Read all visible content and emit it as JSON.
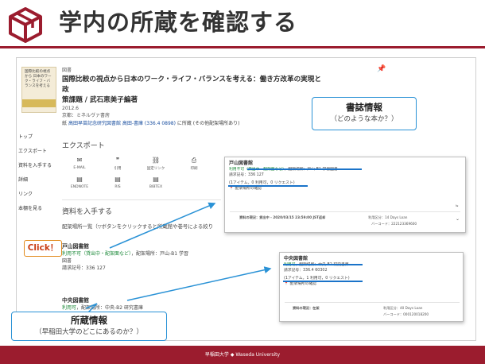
{
  "header": {
    "title": "学内の所蔵を確認する"
  },
  "book": {
    "type": "図書",
    "title_line1": "国際比較の視点から日本のワーク・ライフ・バランスを考える：働き方改革の実現と政",
    "title_line2": "策課題 / 武石恵美子編著",
    "year": "2012.6",
    "publisher": "京都：ミネルヴァ書房",
    "holding_prefix": "紙",
    "holding_library": "高田早苗記念研究図書館 高田-書庫 (336.4 0898)",
    "holding_suffix": "に所蔵 (その他配架場所あり)",
    "cover_text": "国際比較の視点から 日本のワーク・ライフ・バランスを考える"
  },
  "nav": [
    "トップ",
    "エクスポート",
    "資料を入手する",
    "詳細",
    "リンク",
    "本棚を見る"
  ],
  "export": {
    "heading": "エクスポート",
    "items": [
      {
        "icon": "✉",
        "label": "E-MAIL"
      },
      {
        "icon": "❞",
        "label": "引用"
      },
      {
        "icon": "⛓",
        "label": "固定リンク"
      },
      {
        "icon": "⎙",
        "label": "印刷"
      },
      {
        "icon": "▤",
        "label": "ENDNOTE"
      },
      {
        "icon": "▤",
        "label": "RIS"
      },
      {
        "icon": "▤",
        "label": "BIBTEX"
      }
    ]
  },
  "availability": {
    "heading": "資料を入手する",
    "line": "配架場所一覧（▽ボタンをクリックすると所蔵館や巻号による絞り",
    "entries": [
      {
        "name": "戸山図書館",
        "status_green": "利用不可（貸出中・配架面など）",
        "status_rest": "，配架場所：戸山-B1 学習",
        "line3": "図書",
        "request": "請求記号：336 127"
      },
      {
        "name": "中央図書館",
        "status_green": "利用可",
        "status_rest": "，配架場所：中央-B2 研究書庫"
      }
    ]
  },
  "popup1": {
    "name": "戸山図書館",
    "status": "利用不可（貸出中・配架面など）",
    "location": "，配架場所：戸山-B1 学習図書",
    "call": "請求記号：336 127",
    "items": "(1アイテム，0 利用可，0 リクエスト)",
    "map": "配架場所の確認",
    "row_status": "資料の現況：貸出中 - 2020/03/15 23:59:00 JST返却",
    "row_type": "利用区分：14 Days Loan",
    "row_barcode": "バーコード：222123369600"
  },
  "popup2": {
    "name": "中央図書館",
    "status": "利用可",
    "location": "，配架場所：中央-B2 研究書庫",
    "call": "請求記号：336.4 60302",
    "items": "(1アイテム，1 利用可，0 リクエスト)",
    "map": "配架場所の確認",
    "row_status": "資料の現況：在架",
    "row_type": "利用区分：40 Days Loan",
    "row_barcode": "バーコード：000120018200"
  },
  "callouts": {
    "biblio_title": "書誌情報",
    "biblio_sub": "（どのような本か？）",
    "holding_title": "所蔵情報",
    "holding_sub": "（早稲田大学のどこにあるのか？）",
    "click": "Click！"
  },
  "footer": {
    "text": "早稲田大学 ◆ Waseda University"
  },
  "colors": {
    "brand": "#9b1c2e",
    "accent_blue": "#1a73c9",
    "available_green": "#1d8a3a",
    "click_orange": "#e28a1c"
  }
}
